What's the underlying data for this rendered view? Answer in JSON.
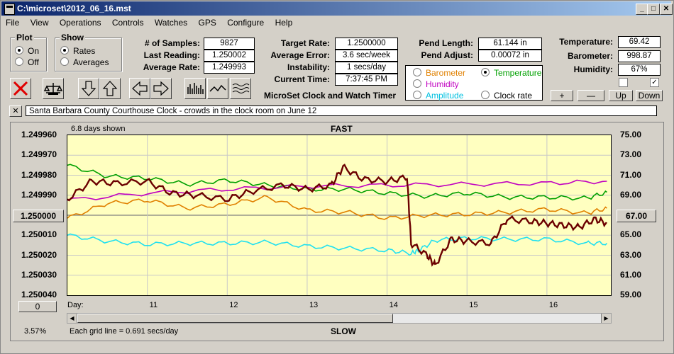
{
  "window": {
    "title": "C:\\microset\\2012_06_16.mst"
  },
  "menu": [
    "File",
    "View",
    "Operations",
    "Controls",
    "Watches",
    "GPS",
    "Configure",
    "Help"
  ],
  "plot_group": {
    "label": "Plot",
    "options": [
      "On",
      "Off"
    ],
    "selected": "On"
  },
  "show_group": {
    "label": "Show",
    "options": [
      "Rates",
      "Averages"
    ],
    "selected": "Rates"
  },
  "stats": {
    "samples": {
      "label": "# of Samples:",
      "value": "9827"
    },
    "last_reading": {
      "label": "Last Reading:",
      "value": "1.250002"
    },
    "average_rate": {
      "label": "Average Rate:",
      "value": "1.249993"
    },
    "target_rate": {
      "label": "Target Rate:",
      "value": "1.2500000"
    },
    "average_error": {
      "label": "Average Error:",
      "value": "3.6 sec/week"
    },
    "instability": {
      "label": "Instability:",
      "value": "1 secs/day"
    },
    "current_time": {
      "label": "Current Time:",
      "value": "7:37:45 PM"
    },
    "pend_length": {
      "label": "Pend Length:",
      "value": "61.144 in"
    },
    "pend_adjust": {
      "label": "Pend Adjust:",
      "value": "0.00072 in"
    },
    "temperature": {
      "label": "Temperature:",
      "value": "69.42"
    },
    "barometer": {
      "label": "Barometer:",
      "value": "998.87"
    },
    "humidity": {
      "label": "Humidity:",
      "value": "67%"
    }
  },
  "app_caption": "MicroSet Clock and Watch Timer",
  "sensor_select": {
    "options": [
      {
        "label": "Barometer",
        "color": "#e08000",
        "selected": false
      },
      {
        "label": "Temperature",
        "color": "#00a000",
        "selected": true
      },
      {
        "label": "Humidity",
        "color": "#c000c0",
        "selected": false
      },
      {
        "label": "Amplitude",
        "color": "#00c0e0",
        "selected": false
      },
      {
        "label": "Clock rate",
        "color": "#000000",
        "selected": false
      }
    ]
  },
  "scale_buttons": [
    "+",
    "—",
    "Up",
    "Down"
  ],
  "checkboxes": [
    false,
    true
  ],
  "notes": "Santa Barbara County Courthouse Clock - crowds in the clock room on June 12",
  "notes_close": "✕",
  "chart": {
    "days_shown": "6.8 days shown",
    "top_label": "FAST",
    "bottom_label": "SLOW",
    "grid_note": "Each grid line = 0.691 secs/day",
    "percent": "3.57%",
    "left_center_button": "1.250000",
    "right_center_button": "67.00",
    "zero_button": "0",
    "day_label": "Day:"
  },
  "chart_data": {
    "type": "line",
    "left_axis": {
      "ticks": [
        "1.249960",
        "1.249970",
        "1.249980",
        "1.249990",
        "1.250000",
        "1.250010",
        "1.250020",
        "1.250030",
        "1.250040"
      ],
      "range": [
        1.24996,
        1.25004
      ],
      "inverted": true
    },
    "right_axis": {
      "ticks": [
        "75.00",
        "73.00",
        "71.00",
        "69.00",
        "67.00",
        "65.00",
        "63.00",
        "61.00",
        "59.00"
      ],
      "range": [
        59,
        75
      ]
    },
    "x_ticks": [
      "11",
      "12",
      "13",
      "14",
      "15",
      "16"
    ],
    "x_range": [
      10.0,
      16.8
    ],
    "grid": true,
    "series": [
      {
        "name": "Clock rate",
        "color": "#6b0000",
        "axis": "left",
        "x": [
          10.0,
          10.3,
          10.6,
          11.0,
          11.3,
          11.6,
          12.0,
          12.3,
          12.7,
          13.0,
          13.3,
          13.45,
          13.7,
          14.0,
          14.25,
          14.3,
          14.5,
          14.6,
          14.8,
          15.0,
          15.3,
          15.5,
          15.8,
          16.0,
          16.2,
          16.4,
          16.6,
          16.75
        ],
        "y": [
          1.249992,
          1.249983,
          1.249984,
          1.249983,
          1.249989,
          1.24999,
          1.249992,
          1.249988,
          1.249985,
          1.249987,
          1.249985,
          1.249976,
          1.249982,
          1.249983,
          1.249981,
          1.250014,
          1.25002,
          1.250025,
          1.250012,
          1.250013,
          1.250014,
          1.250002,
          1.250003,
          1.250004,
          1.250005,
          1.250006,
          1.250002,
          1.250004
        ]
      },
      {
        "name": "Temperature",
        "color": "#00a000",
        "axis": "right",
        "x": [
          10.0,
          10.5,
          11.0,
          11.5,
          12.0,
          12.5,
          13.0,
          13.5,
          14.0,
          14.5,
          15.0,
          15.5,
          16.0,
          16.5,
          16.75
        ],
        "y": [
          72.0,
          70.9,
          70.7,
          70.1,
          70.5,
          70.0,
          69.6,
          69.6,
          69.2,
          68.9,
          69.2,
          68.8,
          68.8,
          68.7,
          69.3
        ]
      },
      {
        "name": "Humidity",
        "color": "#c000c0",
        "axis": "right",
        "x": [
          10.0,
          11.0,
          12.0,
          13.0,
          14.0,
          15.0,
          16.0,
          16.75
        ],
        "y": [
          68.5,
          69.2,
          69.6,
          69.9,
          70.0,
          70.1,
          70.2,
          70.4
        ]
      },
      {
        "name": "Barometer",
        "color": "#e08000",
        "axis": "right",
        "x": [
          10.0,
          10.5,
          11.0,
          11.5,
          12.0,
          12.5,
          13.0,
          13.5,
          14.0,
          14.5,
          15.0,
          15.5,
          16.0,
          16.5,
          16.75
        ],
        "y": [
          66.7,
          68.2,
          68.5,
          67.7,
          68.1,
          68.8,
          67.5,
          67.3,
          66.7,
          67.0,
          67.1,
          67.3,
          67.6,
          67.2,
          67.7
        ]
      },
      {
        "name": "Amplitude",
        "color": "#20e0f0",
        "axis": "right",
        "x": [
          10.0,
          10.5,
          11.0,
          11.5,
          12.0,
          12.5,
          13.0,
          13.5,
          14.0,
          14.3,
          14.4,
          14.6,
          15.0,
          15.5,
          16.0,
          16.5,
          16.75
        ],
        "y": [
          65.0,
          64.4,
          64.1,
          64.2,
          64.2,
          64.3,
          63.9,
          63.7,
          63.5,
          63.2,
          63.5,
          64.5,
          64.7,
          64.6,
          64.6,
          64.2,
          64.2
        ]
      }
    ]
  }
}
